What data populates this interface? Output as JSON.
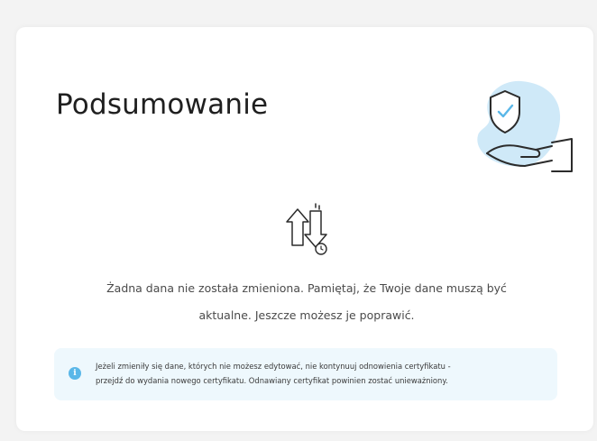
{
  "summary": {
    "title": "Podsumowanie",
    "message_line1": "Żadna dana nie została zmieniona. Pamiętaj, że Twoje dane muszą być",
    "message_line2": "aktualne. Jeszcze możesz je poprawić.",
    "info_line1": "Jeżeli zmieniły się dane, których nie możesz edytować, nie kontynuuj odnowienia certyfikatu -",
    "info_line2": "przejdź do wydania nowego certyfikatu. Odnawiany certyfikat powinien zostać unieważniony.",
    "info_icon_glyph": "i"
  },
  "icons": {
    "hero": "shield-check-hand-icon",
    "center": "data-exchange-arrows-icon",
    "info": "info-icon"
  },
  "colors": {
    "accent_blue": "#5ab7e8",
    "blob_blue": "#cfe9f8",
    "info_background": "#eef8fd",
    "card_background": "#ffffff",
    "page_background": "#f3f3f3"
  }
}
